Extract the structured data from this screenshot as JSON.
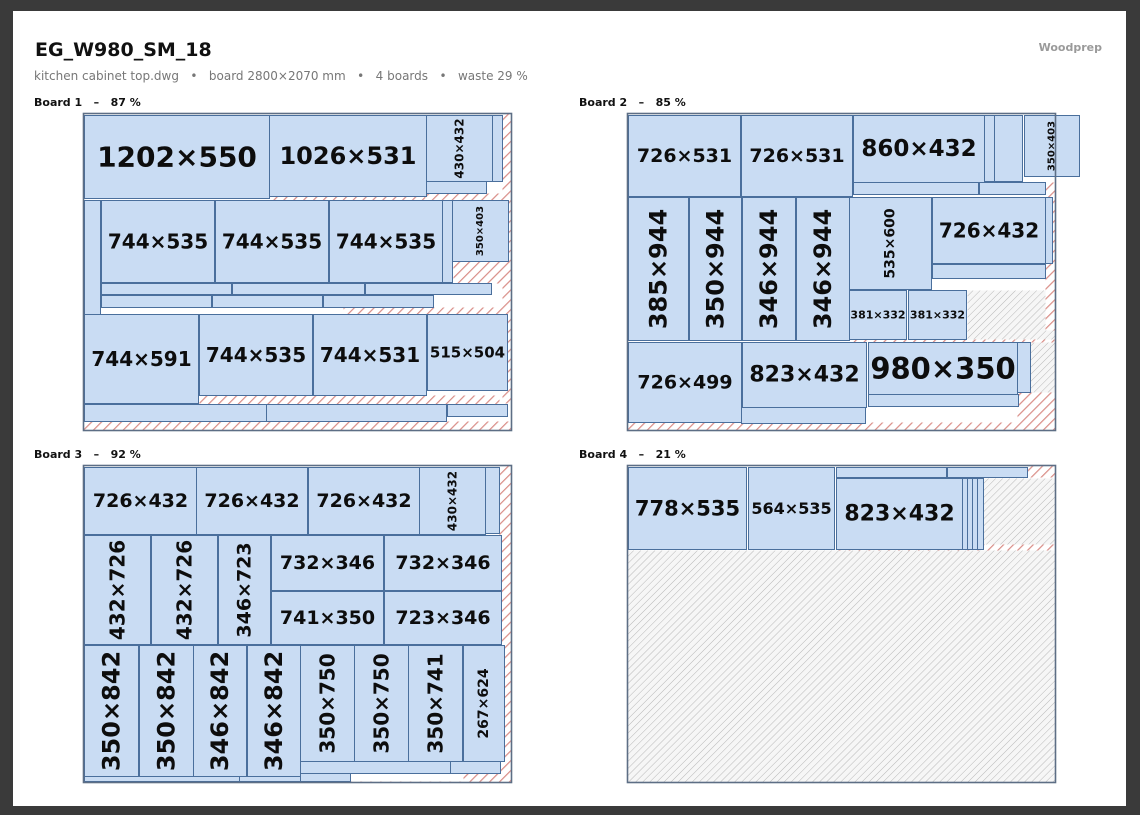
{
  "header": {
    "title": "EG_W980_SM_18",
    "subtitle": "kitchen cabinet top.dwg   •   board 2800×2070 mm   •   4 boards   •   waste 29 %",
    "brand": "Woodprep"
  },
  "colors": {
    "panel_fill": "#c9dcf3",
    "panel_stroke": "#4a6f9c",
    "kerf_waste_hatch": "#d98c86",
    "offcut_hatch": "#a9a9a9",
    "board_frame": "#5d6e85"
  },
  "boards": [
    {
      "label": "Board 1   –   87 %",
      "parts": [
        {
          "label": "1202×550"
        },
        {
          "label": "1026×531"
        },
        {
          "label": "430×432"
        },
        {
          "label": "744×535"
        },
        {
          "label": "744×535"
        },
        {
          "label": "744×535"
        },
        {
          "label": "350×403"
        },
        {
          "label": "744×591"
        },
        {
          "label": "744×535"
        },
        {
          "label": "744×531"
        },
        {
          "label": "515×504"
        }
      ]
    },
    {
      "label": "Board 2   –   85 %",
      "parts": [
        {
          "label": "726×531"
        },
        {
          "label": "726×531"
        },
        {
          "label": "860×432"
        },
        {
          "label": "350×403"
        },
        {
          "label": "385×944"
        },
        {
          "label": "350×944"
        },
        {
          "label": "346×944"
        },
        {
          "label": "346×944"
        },
        {
          "label": "535×600"
        },
        {
          "label": "726×432"
        },
        {
          "label": "381×332"
        },
        {
          "label": "381×332"
        },
        {
          "label": "726×499"
        },
        {
          "label": "823×432"
        },
        {
          "label": "980×350"
        }
      ]
    },
    {
      "label": "Board 3   –   92 %",
      "parts": [
        {
          "label": "726×432"
        },
        {
          "label": "726×432"
        },
        {
          "label": "726×432"
        },
        {
          "label": "430×432"
        },
        {
          "label": "432×726"
        },
        {
          "label": "432×726"
        },
        {
          "label": "346×723"
        },
        {
          "label": "732×346"
        },
        {
          "label": "732×346"
        },
        {
          "label": "741×350"
        },
        {
          "label": "723×346"
        },
        {
          "label": "350×842"
        },
        {
          "label": "350×842"
        },
        {
          "label": "346×842"
        },
        {
          "label": "346×842"
        },
        {
          "label": "350×750"
        },
        {
          "label": "350×750"
        },
        {
          "label": "350×741"
        },
        {
          "label": "267×624"
        }
      ]
    },
    {
      "label": "Board 4   –   21 %",
      "parts": [
        {
          "label": "778×535"
        },
        {
          "label": "564×535"
        },
        {
          "label": "823×432"
        }
      ]
    }
  ]
}
